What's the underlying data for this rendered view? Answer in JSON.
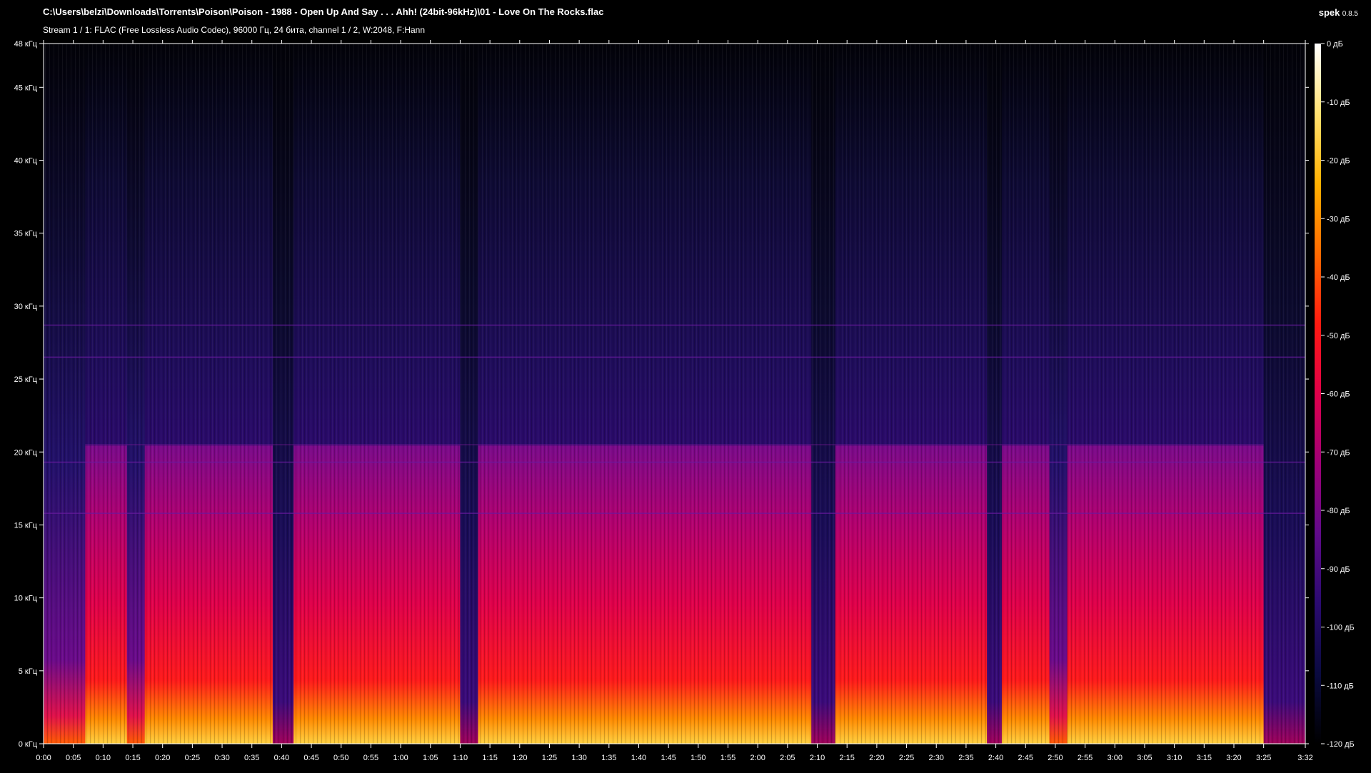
{
  "header": {
    "file_path": "C:\\Users\\belzi\\Downloads\\Torrents\\Poison\\Poison - 1988 - Open Up And Say . . . Ahh! (24bit-96kHz)\\01 - Love On The Rocks.flac",
    "stream_info": "Stream 1 / 1: FLAC (Free Lossless Audio Codec), 96000 Гц, 24 бита, channel 1 / 2, W:2048, F:Hann",
    "app_name": "spek",
    "app_version": "0.8.5"
  },
  "colors": {
    "background": "#000000",
    "axis": "#ffffff",
    "palette": [
      "#000000",
      "#12104a",
      "#3a0a7a",
      "#7a0a8a",
      "#c0006a",
      "#ff1020",
      "#ff6a00",
      "#ffb000",
      "#ffe060",
      "#ffffff"
    ]
  },
  "chart_data": {
    "type": "heatmap",
    "title": "C:\\Users\\belzi\\Downloads\\Torrents\\Poison\\Poison - 1988 - Open Up And Say . . . Ahh! (24bit-96kHz)\\01 - Love On The Rocks.flac",
    "x_ticks": [
      "0:00",
      "0:05",
      "0:10",
      "0:15",
      "0:20",
      "0:25",
      "0:30",
      "0:35",
      "0:40",
      "0:45",
      "0:50",
      "0:55",
      "1:00",
      "1:05",
      "1:10",
      "1:15",
      "1:20",
      "1:25",
      "1:30",
      "1:35",
      "1:40",
      "1:45",
      "1:50",
      "1:55",
      "2:00",
      "2:05",
      "2:10",
      "2:15",
      "2:20",
      "2:25",
      "2:30",
      "2:35",
      "2:40",
      "2:45",
      "2:50",
      "2:55",
      "3:00",
      "3:05",
      "3:10",
      "3:15",
      "3:20",
      "3:25",
      "3:32"
    ],
    "x_tick_seconds": [
      0,
      5,
      10,
      15,
      20,
      25,
      30,
      35,
      40,
      45,
      50,
      55,
      60,
      65,
      70,
      75,
      80,
      85,
      90,
      95,
      100,
      105,
      110,
      115,
      120,
      125,
      130,
      135,
      140,
      145,
      150,
      155,
      160,
      165,
      170,
      175,
      180,
      185,
      190,
      195,
      200,
      205,
      212
    ],
    "x_range_seconds": [
      0,
      212
    ],
    "y_ticks": [
      "0 кГц",
      "5 кГц",
      "10 кГц",
      "15 кГц",
      "20 кГц",
      "25 кГц",
      "30 кГц",
      "35 кГц",
      "40 кГц",
      "45 кГц",
      "48 кГц"
    ],
    "y_tick_khz": [
      0,
      5,
      10,
      15,
      20,
      25,
      30,
      35,
      40,
      45,
      48
    ],
    "y_range_khz": [
      0,
      48
    ],
    "colorbar_ticks": [
      "0 дБ",
      "-10 дБ",
      "-20 дБ",
      "-30 дБ",
      "-40 дБ",
      "-50 дБ",
      "-60 дБ",
      "-70 дБ",
      "-80 дБ",
      "-90 дБ",
      "-100 дБ",
      "-110 дБ",
      "-120 дБ"
    ],
    "colorbar_db": [
      0,
      -10,
      -20,
      -30,
      -40,
      -50,
      -60,
      -70,
      -80,
      -90,
      -100,
      -110,
      -120
    ],
    "colorbar_range_db": [
      -120,
      0
    ],
    "cutoff_khz": 20.5,
    "music_segments_seconds": [
      [
        7,
        14
      ],
      [
        17,
        40
      ],
      [
        42,
        70
      ],
      [
        73,
        169
      ],
      [
        172,
        205
      ]
    ],
    "gaps_seconds": [
      [
        38.5,
        42
      ],
      [
        70,
        73
      ],
      [
        129,
        133
      ],
      [
        158.5,
        161
      ],
      [
        205,
        212
      ]
    ],
    "tonal_lines_khz": [
      15.8,
      19.3,
      26.5,
      28.7
    ],
    "grid": false
  }
}
